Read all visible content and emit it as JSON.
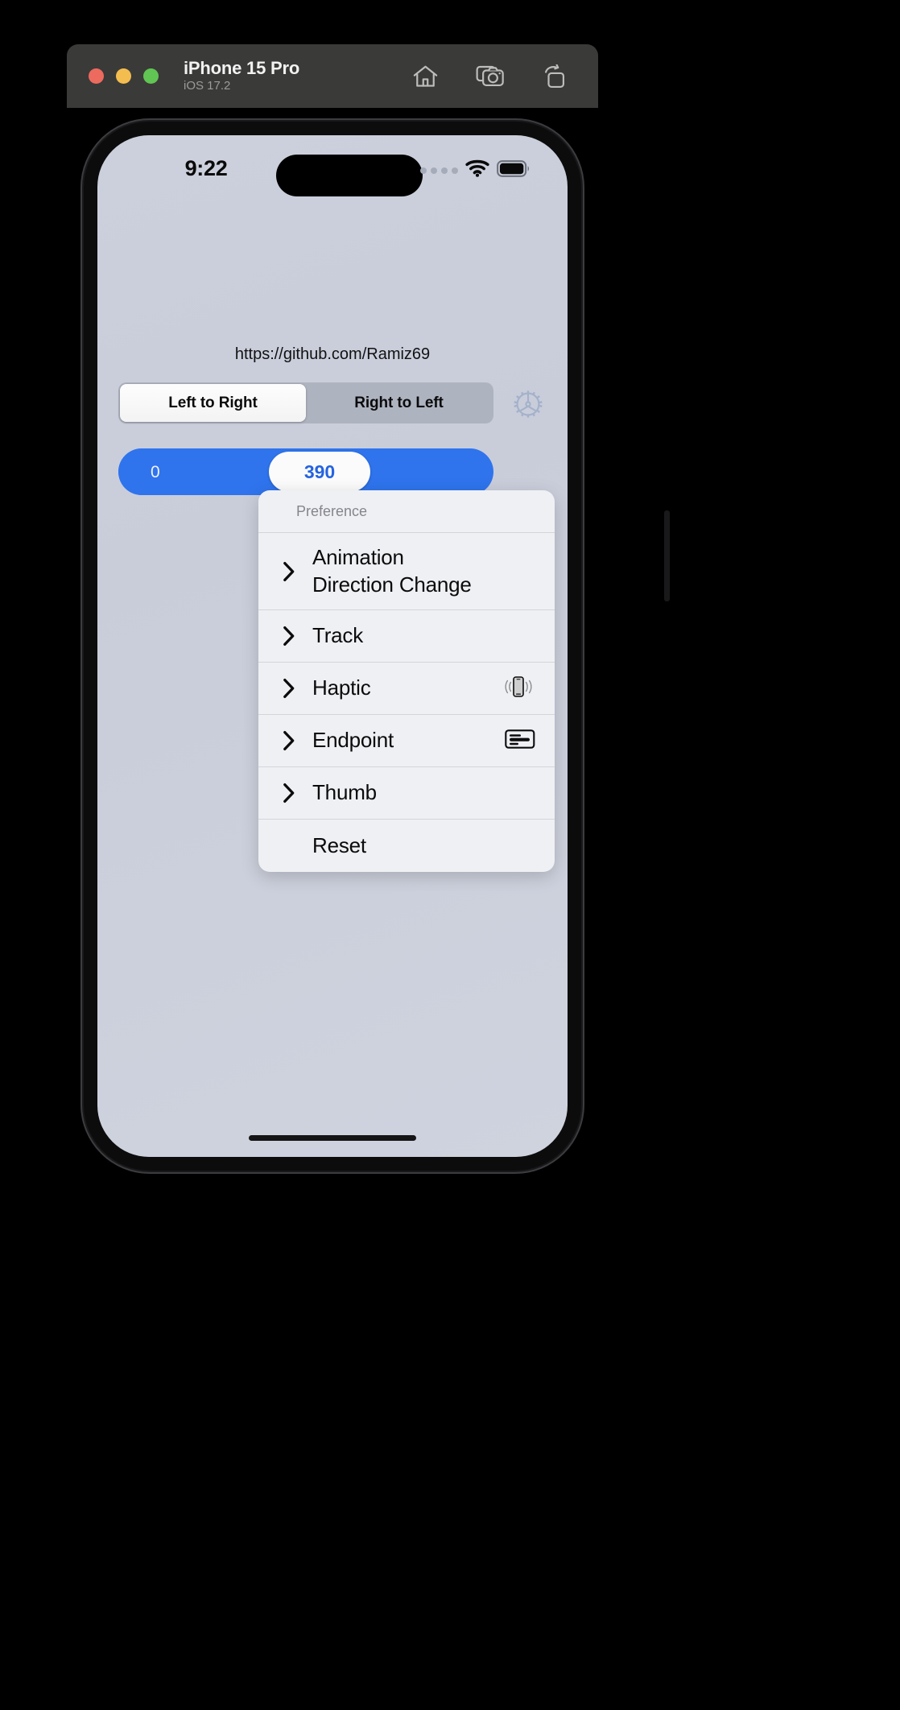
{
  "simulator": {
    "device_name": "iPhone 15 Pro",
    "os_version": "iOS 17.2",
    "window_controls": [
      {
        "name": "close",
        "color": "#ed6a5e"
      },
      {
        "name": "minimize",
        "color": "#f4bd4f"
      },
      {
        "name": "zoom",
        "color": "#61c554"
      }
    ],
    "toolbar_icons": [
      {
        "name": "home-icon",
        "label": "Home"
      },
      {
        "name": "screenshot-icon",
        "label": "Screenshot"
      },
      {
        "name": "rotate-icon",
        "label": "Rotate"
      }
    ],
    "titlebar_bg": "#3a3a38"
  },
  "status_bar": {
    "time": "9:22",
    "cellular_dots": 4,
    "wifi": "wifi-icon",
    "battery": "battery-full-icon"
  },
  "app": {
    "url": "https://github.com/Ramiz69",
    "segmented_control": {
      "options": [
        "Left to Right",
        "Right to Left"
      ],
      "selected_index": 0,
      "selected": "Left to Right"
    },
    "settings_button": "gear-icon",
    "slider": {
      "min_label": "0",
      "value_label": "390",
      "fill_percent": 55,
      "track_color": "#2f74ed",
      "value_color": "#2563e0"
    }
  },
  "menu": {
    "header": "Preference",
    "items": [
      {
        "label": "Animation\nDirection Change",
        "chevron": true,
        "trailing": null,
        "two_line": true
      },
      {
        "label": "Track",
        "chevron": true,
        "trailing": null,
        "two_line": false
      },
      {
        "label": "Haptic",
        "chevron": true,
        "trailing": "haptic-icon",
        "two_line": false
      },
      {
        "label": "Endpoint",
        "chevron": true,
        "trailing": "endpoint-icon",
        "two_line": false
      },
      {
        "label": "Thumb",
        "chevron": true,
        "trailing": null,
        "two_line": false
      },
      {
        "label": "Reset",
        "chevron": false,
        "trailing": null,
        "two_line": false
      }
    ],
    "bg": "#eff0f4",
    "separator": "#d4d5da"
  }
}
